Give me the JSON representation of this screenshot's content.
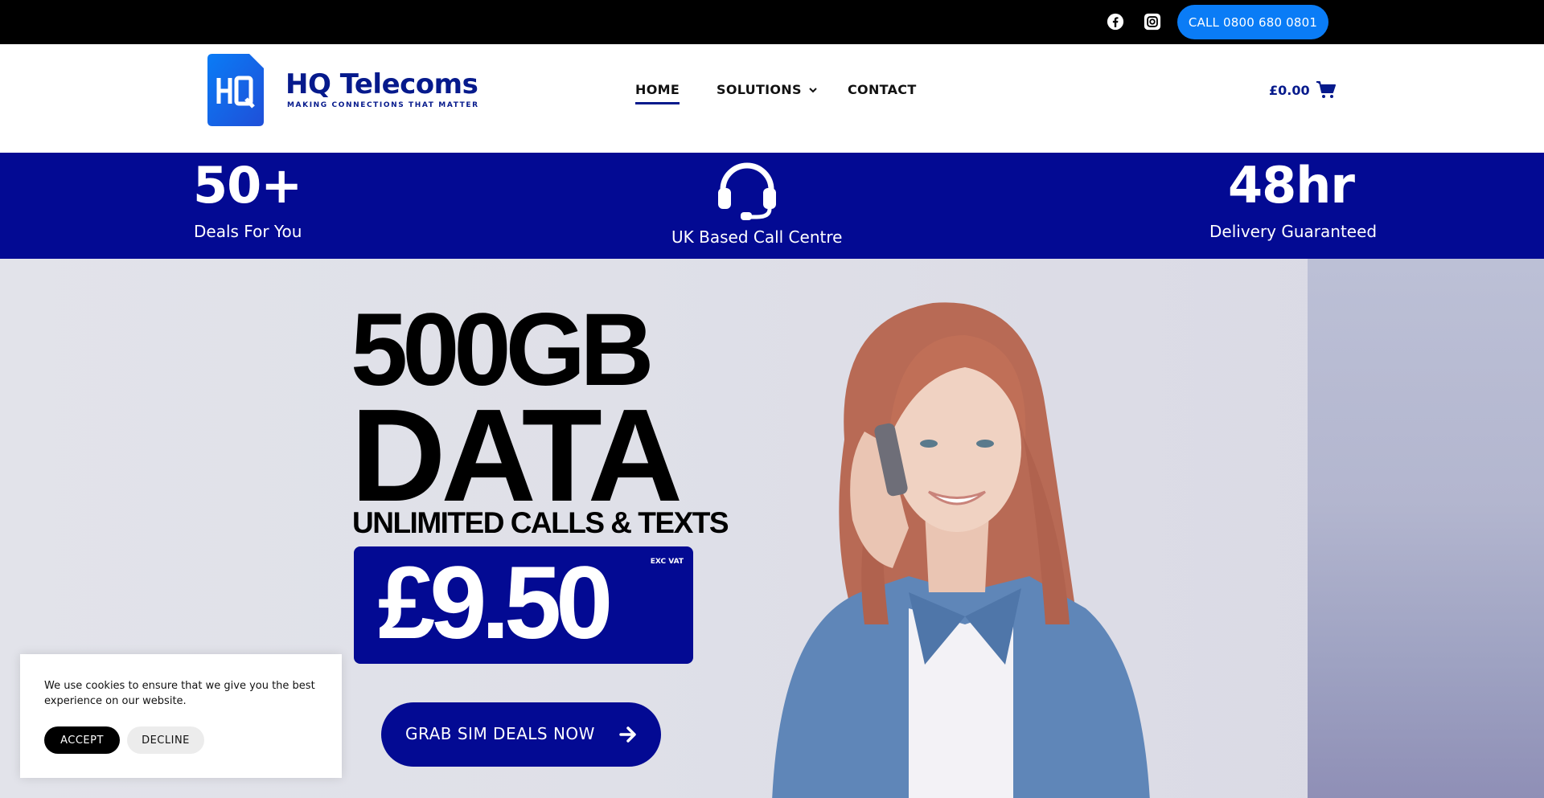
{
  "topbar": {
    "facebook_icon": "facebook-icon",
    "instagram_icon": "instagram-icon",
    "call_label": "CALL 0800 680 0801"
  },
  "header": {
    "logo_mark_text": "HQ",
    "logo_title": "HQ Telecoms",
    "logo_tagline": "MAKING CONNECTIONS THAT MATTER",
    "nav": {
      "home": "HOME",
      "solutions": "SOLUTIONS",
      "contact": "CONTACT"
    },
    "cart_amount": "£0.00",
    "cart_icon": "cart-icon"
  },
  "stats": {
    "deals_value": "50+",
    "deals_label": "Deals For You",
    "call_centre_icon": "headset-icon",
    "call_centre_label": "UK Based Call Centre",
    "delivery_value": "48hr",
    "delivery_label": "Delivery Guaranteed"
  },
  "hero": {
    "line1": "500GB",
    "line2": "DATA",
    "line3": "UNLIMITED CALLS & TEXTS",
    "price": "£9.50",
    "price_note": "EXC VAT",
    "cta_label": "GRAB SIM DEALS NOW"
  },
  "cookie": {
    "text": "We use cookies to ensure that we give you the best experience on our website.",
    "accept": "ACCEPT",
    "decline": "DECLINE"
  },
  "colors": {
    "brand_navy": "#030a93",
    "call_button_blue": "#0a7cf6",
    "topbar": "#000000"
  }
}
